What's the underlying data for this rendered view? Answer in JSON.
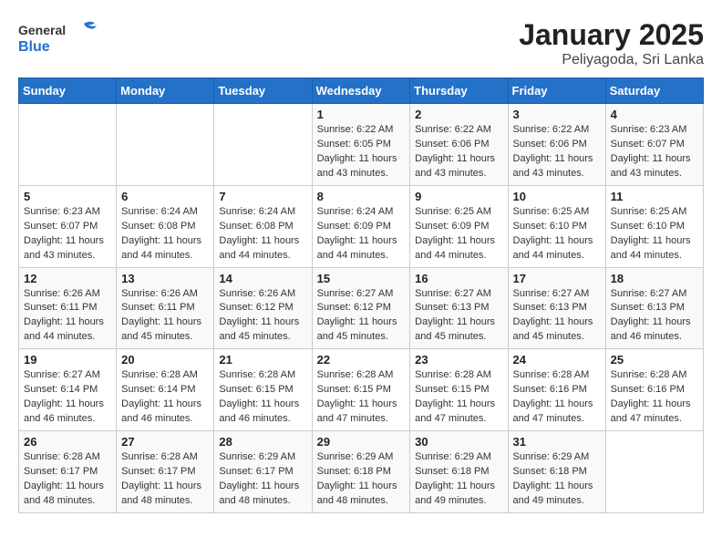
{
  "logo": {
    "general": "General",
    "blue": "Blue"
  },
  "title": "January 2025",
  "subtitle": "Peliyagoda, Sri Lanka",
  "weekdays": [
    "Sunday",
    "Monday",
    "Tuesday",
    "Wednesday",
    "Thursday",
    "Friday",
    "Saturday"
  ],
  "weeks": [
    [
      {
        "day": "",
        "info": ""
      },
      {
        "day": "",
        "info": ""
      },
      {
        "day": "",
        "info": ""
      },
      {
        "day": "1",
        "info": "Sunrise: 6:22 AM\nSunset: 6:05 PM\nDaylight: 11 hours and 43 minutes."
      },
      {
        "day": "2",
        "info": "Sunrise: 6:22 AM\nSunset: 6:06 PM\nDaylight: 11 hours and 43 minutes."
      },
      {
        "day": "3",
        "info": "Sunrise: 6:22 AM\nSunset: 6:06 PM\nDaylight: 11 hours and 43 minutes."
      },
      {
        "day": "4",
        "info": "Sunrise: 6:23 AM\nSunset: 6:07 PM\nDaylight: 11 hours and 43 minutes."
      }
    ],
    [
      {
        "day": "5",
        "info": "Sunrise: 6:23 AM\nSunset: 6:07 PM\nDaylight: 11 hours and 43 minutes."
      },
      {
        "day": "6",
        "info": "Sunrise: 6:24 AM\nSunset: 6:08 PM\nDaylight: 11 hours and 44 minutes."
      },
      {
        "day": "7",
        "info": "Sunrise: 6:24 AM\nSunset: 6:08 PM\nDaylight: 11 hours and 44 minutes."
      },
      {
        "day": "8",
        "info": "Sunrise: 6:24 AM\nSunset: 6:09 PM\nDaylight: 11 hours and 44 minutes."
      },
      {
        "day": "9",
        "info": "Sunrise: 6:25 AM\nSunset: 6:09 PM\nDaylight: 11 hours and 44 minutes."
      },
      {
        "day": "10",
        "info": "Sunrise: 6:25 AM\nSunset: 6:10 PM\nDaylight: 11 hours and 44 minutes."
      },
      {
        "day": "11",
        "info": "Sunrise: 6:25 AM\nSunset: 6:10 PM\nDaylight: 11 hours and 44 minutes."
      }
    ],
    [
      {
        "day": "12",
        "info": "Sunrise: 6:26 AM\nSunset: 6:11 PM\nDaylight: 11 hours and 44 minutes."
      },
      {
        "day": "13",
        "info": "Sunrise: 6:26 AM\nSunset: 6:11 PM\nDaylight: 11 hours and 45 minutes."
      },
      {
        "day": "14",
        "info": "Sunrise: 6:26 AM\nSunset: 6:12 PM\nDaylight: 11 hours and 45 minutes."
      },
      {
        "day": "15",
        "info": "Sunrise: 6:27 AM\nSunset: 6:12 PM\nDaylight: 11 hours and 45 minutes."
      },
      {
        "day": "16",
        "info": "Sunrise: 6:27 AM\nSunset: 6:13 PM\nDaylight: 11 hours and 45 minutes."
      },
      {
        "day": "17",
        "info": "Sunrise: 6:27 AM\nSunset: 6:13 PM\nDaylight: 11 hours and 45 minutes."
      },
      {
        "day": "18",
        "info": "Sunrise: 6:27 AM\nSunset: 6:13 PM\nDaylight: 11 hours and 46 minutes."
      }
    ],
    [
      {
        "day": "19",
        "info": "Sunrise: 6:27 AM\nSunset: 6:14 PM\nDaylight: 11 hours and 46 minutes."
      },
      {
        "day": "20",
        "info": "Sunrise: 6:28 AM\nSunset: 6:14 PM\nDaylight: 11 hours and 46 minutes."
      },
      {
        "day": "21",
        "info": "Sunrise: 6:28 AM\nSunset: 6:15 PM\nDaylight: 11 hours and 46 minutes."
      },
      {
        "day": "22",
        "info": "Sunrise: 6:28 AM\nSunset: 6:15 PM\nDaylight: 11 hours and 47 minutes."
      },
      {
        "day": "23",
        "info": "Sunrise: 6:28 AM\nSunset: 6:15 PM\nDaylight: 11 hours and 47 minutes."
      },
      {
        "day": "24",
        "info": "Sunrise: 6:28 AM\nSunset: 6:16 PM\nDaylight: 11 hours and 47 minutes."
      },
      {
        "day": "25",
        "info": "Sunrise: 6:28 AM\nSunset: 6:16 PM\nDaylight: 11 hours and 47 minutes."
      }
    ],
    [
      {
        "day": "26",
        "info": "Sunrise: 6:28 AM\nSunset: 6:17 PM\nDaylight: 11 hours and 48 minutes."
      },
      {
        "day": "27",
        "info": "Sunrise: 6:28 AM\nSunset: 6:17 PM\nDaylight: 11 hours and 48 minutes."
      },
      {
        "day": "28",
        "info": "Sunrise: 6:29 AM\nSunset: 6:17 PM\nDaylight: 11 hours and 48 minutes."
      },
      {
        "day": "29",
        "info": "Sunrise: 6:29 AM\nSunset: 6:18 PM\nDaylight: 11 hours and 48 minutes."
      },
      {
        "day": "30",
        "info": "Sunrise: 6:29 AM\nSunset: 6:18 PM\nDaylight: 11 hours and 49 minutes."
      },
      {
        "day": "31",
        "info": "Sunrise: 6:29 AM\nSunset: 6:18 PM\nDaylight: 11 hours and 49 minutes."
      },
      {
        "day": "",
        "info": ""
      }
    ]
  ]
}
